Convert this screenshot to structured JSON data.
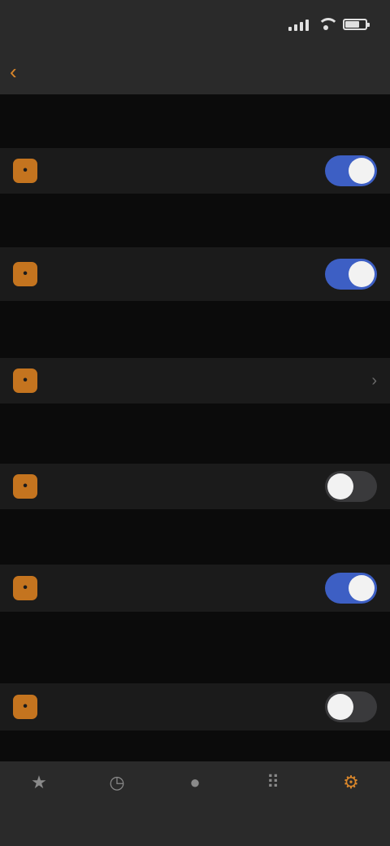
{
  "status_bar": {
    "time": "",
    "battery_level": 0.7
  },
  "nav": {
    "back_label": "",
    "title": ""
  },
  "rows": [
    {
      "label": "",
      "toggle": true
    },
    {
      "label": "",
      "sublabel": "",
      "toggle": true
    },
    {
      "label": "",
      "value": ""
    },
    {
      "label": "",
      "toggle": false
    },
    {
      "label": "",
      "toggle": true
    },
    {
      "label": "",
      "toggle": false
    }
  ],
  "footnotes": [
    "",
    "",
    "",
    "",
    ""
  ],
  "tabs": [
    {
      "label": "",
      "icon": "star-icon",
      "active": false
    },
    {
      "label": "",
      "icon": "clock-icon",
      "active": false
    },
    {
      "label": "",
      "icon": "person-icon",
      "active": false
    },
    {
      "label": "",
      "icon": "keypad-icon",
      "active": false
    },
    {
      "label": "",
      "icon": "gear-icon",
      "active": true
    }
  ],
  "colors": {
    "accent": "#d9862a",
    "toggle_on": "#3d5fc4",
    "background": "#0b0b0b",
    "row_background": "#1b1b1b",
    "bar_background": "#2a2a2a"
  }
}
